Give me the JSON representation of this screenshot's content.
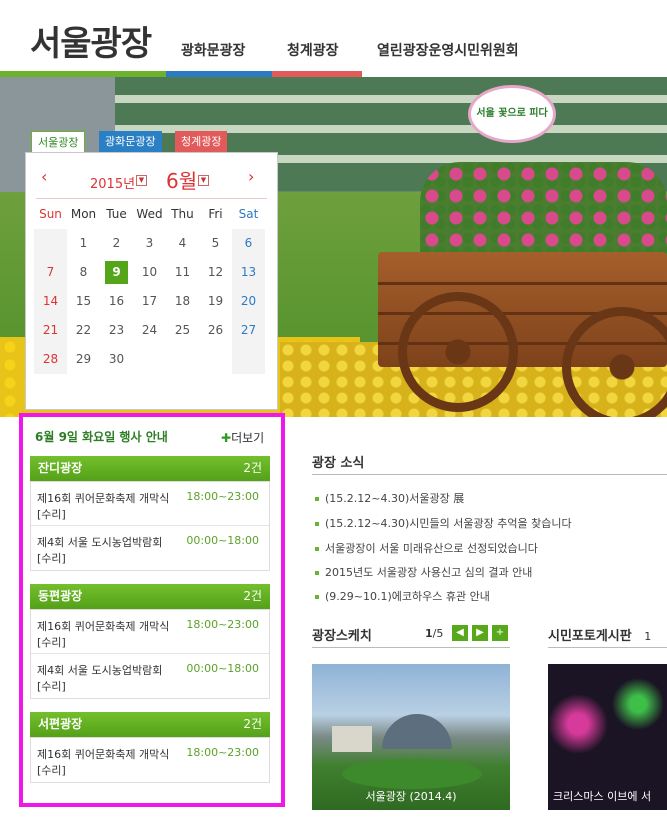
{
  "header": {
    "site_title": "서울광장",
    "nav": [
      "광화문광장",
      "청계광장",
      "열린광장운영시민위원회"
    ],
    "colors": [
      "#6cb22d",
      "#2b7bc4",
      "#e35a5a"
    ]
  },
  "hero": {
    "sign_text": "서울 꽃으로 피다"
  },
  "calendar": {
    "tabs": [
      {
        "label": "서울광장",
        "color": "#ffffff"
      },
      {
        "label": "광화문광장",
        "color": "#2b80c5"
      },
      {
        "label": "청계광장",
        "color": "#e35a5a"
      }
    ],
    "prev": "‹",
    "next": "›",
    "year": "2015년",
    "month": "6월",
    "dropdown_icon": "▼",
    "weekdays": [
      "Sun",
      "Mon",
      "Tue",
      "Wed",
      "Thu",
      "Fri",
      "Sat"
    ],
    "weeks": [
      [
        "",
        "1",
        "2",
        "3",
        "4",
        "5",
        "6"
      ],
      [
        "7",
        "8",
        "9",
        "10",
        "11",
        "12",
        "13"
      ],
      [
        "14",
        "15",
        "16",
        "17",
        "18",
        "19",
        "20"
      ],
      [
        "21",
        "22",
        "23",
        "24",
        "25",
        "26",
        "27"
      ],
      [
        "28",
        "29",
        "30",
        "",
        "",
        "",
        ""
      ]
    ],
    "selected": "9"
  },
  "events": {
    "title": "6월 9일 화요일 행사 안내",
    "more": "더보기",
    "venues": [
      {
        "name": "잔디광장",
        "count": "2건",
        "items": [
          {
            "title": "제16회 퀴어문화축제 개막식",
            "time": "18:00~23:00",
            "status": "[수리]"
          },
          {
            "title": "제4회 서울 도시농업박람회",
            "time": "00:00~18:00",
            "status": "[수리]"
          }
        ]
      },
      {
        "name": "동편광장",
        "count": "2건",
        "items": [
          {
            "title": "제16회 퀴어문화축제 개막식",
            "time": "18:00~23:00",
            "status": "[수리]"
          },
          {
            "title": "제4회 서울 도시농업박람회",
            "time": "00:00~18:00",
            "status": "[수리]"
          }
        ]
      },
      {
        "name": "서편광장",
        "count": "2건",
        "items": [
          {
            "title": "제16회 퀴어문화축제 개막식",
            "time": "18:00~23:00",
            "status": "[수리]"
          }
        ]
      }
    ]
  },
  "news": {
    "title": "광장 소식",
    "items": [
      "(15.2.12~4.30)서울광장 展",
      "(15.2.12~4.30)시민들의 서울광장 추억을 찾습니다",
      "서울광장이 서울 미래유산으로 선정되었습니다",
      "2015년도 서울광장 사용신고 심의 결과 안내",
      "(9.29~10.1)에코하우스 휴관 안내"
    ]
  },
  "sketch": {
    "title": "광장스케치",
    "page": "1",
    "total": "/5",
    "prev": "◀",
    "next": "▶",
    "add": "+",
    "caption": "서울광장 (2014.4)"
  },
  "photo": {
    "title": "시민포토게시판",
    "page": "1",
    "caption": "크리스마스 이브에 서"
  }
}
